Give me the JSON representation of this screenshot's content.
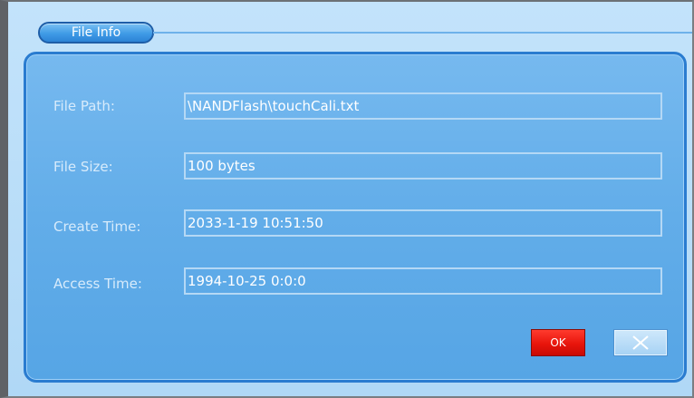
{
  "dialog": {
    "title": "File Info"
  },
  "fields": [
    {
      "label": "File Path:",
      "value": "\\NANDFlash\\touchCali.txt"
    },
    {
      "label": "File Size:",
      "value": "100 bytes"
    },
    {
      "label": "Create Time:",
      "value": "2033-1-19 10:51:50"
    },
    {
      "label": "Access Time:",
      "value": "1994-10-25 0:0:0"
    }
  ],
  "buttons": {
    "ok_label": "OK",
    "close_icon": "close-icon"
  },
  "colors": {
    "ok_button": "#e8150c",
    "panel": "#62ade9",
    "background": "#b0d8f6"
  }
}
